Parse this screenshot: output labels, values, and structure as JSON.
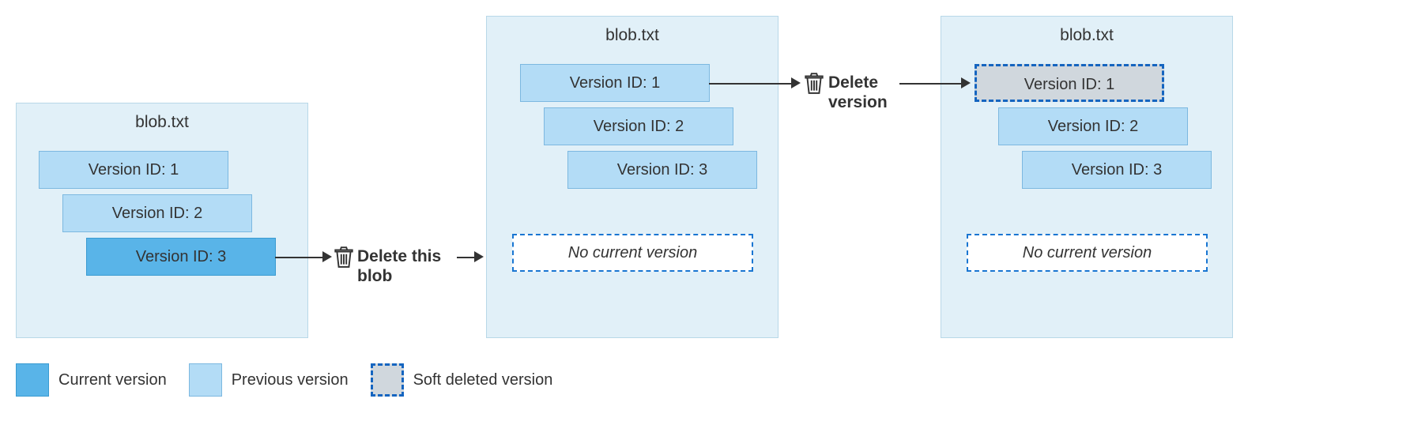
{
  "panels": {
    "p1": {
      "title": "blob.txt",
      "v1": "Version ID: 1",
      "v2": "Version ID: 2",
      "v3": "Version ID: 3"
    },
    "p2": {
      "title": "blob.txt",
      "v1": "Version ID: 1",
      "v2": "Version ID: 2",
      "v3": "Version ID: 3",
      "no_current": "No current version"
    },
    "p3": {
      "title": "blob.txt",
      "v1": "Version ID: 1",
      "v2": "Version ID: 2",
      "v3": "Version ID: 3",
      "no_current": "No current version"
    }
  },
  "actions": {
    "a1": "Delete this blob",
    "a2": "Delete version"
  },
  "legend": {
    "current": "Current version",
    "previous": "Previous version",
    "soft": "Soft deleted version"
  }
}
